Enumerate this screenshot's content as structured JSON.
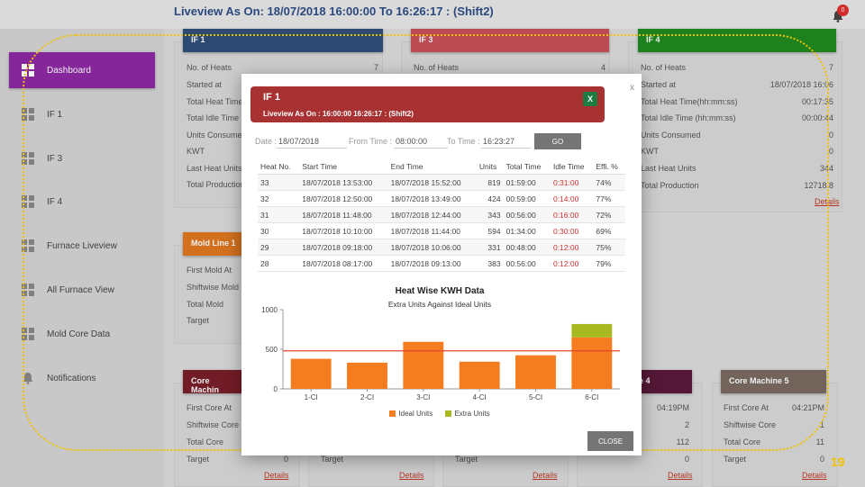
{
  "header": {
    "title": "Liveview As On: 18/07/2018 16:00:00 To 16:26:17   : (Shift2)",
    "notifications_count": "0"
  },
  "sidebar": {
    "items": [
      {
        "label": "Dashboard",
        "icon": "grid-icon",
        "active": true
      },
      {
        "label": "IF 1",
        "icon": "grid-icon"
      },
      {
        "label": "IF 3",
        "icon": "grid-icon"
      },
      {
        "label": "IF 4",
        "icon": "grid-icon"
      },
      {
        "label": "Furnace Liveview",
        "icon": "grid-icon"
      },
      {
        "label": "All Furnace View",
        "icon": "grid-icon"
      },
      {
        "label": "Mold Core Data",
        "icon": "grid-icon"
      },
      {
        "label": "Notifications",
        "icon": "bell-icon"
      }
    ]
  },
  "cards": {
    "if1": {
      "title": "IF 1",
      "color": "#2f4f7a",
      "rows": [
        "No. of Heats",
        "Started at",
        "Total Heat Time",
        "Total Idle Time",
        "Units Consume",
        "KWT",
        "Last Heat Units",
        "Total Production"
      ],
      "values": [
        "7"
      ]
    },
    "if3": {
      "title": "IF 3",
      "color": "#c8505a",
      "rows": [
        "No. of Heats"
      ],
      "values": [
        "4"
      ]
    },
    "if4": {
      "title": "IF 4",
      "color": "#1f8a1f",
      "rows": [
        "No. of Heats",
        "Started at",
        "Total Heat Time(hh:mm:ss)",
        "Total Idle Time (hh:mm:ss)",
        "Units Consumed",
        "KWT",
        "Last Heat Units",
        "Total Production"
      ],
      "values": [
        "7",
        "18/07/2018 16:06",
        "00:17:35",
        "00:00:44",
        "0",
        "0",
        "344",
        "12718.8"
      ],
      "details": "Details"
    },
    "mold1": {
      "title": "Mold Line 1",
      "color": "#e07820",
      "rows": [
        "First Mold At",
        "Shiftwise Mold",
        "Total Mold",
        "Target"
      ]
    },
    "core1": {
      "title": "Core Machin",
      "color": "#7a1e2a",
      "rows": [
        "First Core At",
        "Shiftwise Core",
        "Total Core",
        "Target"
      ],
      "values": [
        "0"
      ],
      "details": "Details"
    },
    "core2": {
      "rows": [
        "Target"
      ],
      "values": [
        "0"
      ],
      "details": "Details"
    },
    "core3": {
      "rows": [
        "Target"
      ],
      "values": [
        "0"
      ],
      "details": "Details"
    },
    "core4": {
      "title": "e 4",
      "color": "#5a1a3a",
      "values": [
        "04:19PM",
        "2",
        "112",
        "0"
      ],
      "details": "Details"
    },
    "core5": {
      "title": "Core Machine 5",
      "color": "#7a6b60",
      "rows": [
        "First Core At",
        "Shiftwise Core",
        "Total Core",
        "Target"
      ],
      "values": [
        "04:21PM",
        "1",
        "11",
        "0"
      ],
      "details": "Details"
    }
  },
  "slide_number": "19",
  "modal": {
    "close_x": "x",
    "title": "IF 1",
    "subtitle": "Liveview As On : 16:00:00  16:26:17 : (Shift2)",
    "excel_label": "X",
    "filters": {
      "date_label": "Date :",
      "date_value": "18/07/2018",
      "from_label": "From Time :",
      "from_value": "08:00:00",
      "to_label": "To Time :",
      "to_value": "16:23:27",
      "go_label": "GO"
    },
    "table": {
      "headers": [
        "Heat No.",
        "Start Time",
        "End Time",
        "Units",
        "Total Time",
        "Idle Time",
        "Effi. %"
      ],
      "rows": [
        [
          "33",
          "18/07/2018 13:53:00",
          "18/07/2018 15:52:00",
          "819",
          "01:59:00",
          "0:31:00",
          "74%"
        ],
        [
          "32",
          "18/07/2018 12:50:00",
          "18/07/2018 13:49:00",
          "424",
          "00:59:00",
          "0:14:00",
          "77%"
        ],
        [
          "31",
          "18/07/2018 11:48:00",
          "18/07/2018 12:44:00",
          "343",
          "00:56:00",
          "0:16:00",
          "72%"
        ],
        [
          "30",
          "18/07/2018 10:10:00",
          "18/07/2018 11:44:00",
          "594",
          "01:34:00",
          "0:30:00",
          "69%"
        ],
        [
          "29",
          "18/07/2018 09:18:00",
          "18/07/2018 10:06:00",
          "331",
          "00:48:00",
          "0:12:00",
          "75%"
        ],
        [
          "28",
          "18/07/2018 08:17:00",
          "18/07/2018 09:13:00",
          "383",
          "00:56:00",
          "0:12:00",
          "79%"
        ]
      ]
    },
    "close_label": "CLOSE"
  },
  "chart_data": {
    "type": "bar",
    "title": "Heat Wise KWH Data",
    "subtitle": "Extra Units Against Ideal Units",
    "categories": [
      "1-CI",
      "2-CI",
      "3-CI",
      "4-CI",
      "5-CI",
      "6-CI"
    ],
    "series": [
      {
        "name": "Ideal Units",
        "values": [
          380,
          331,
          594,
          343,
          424,
          650
        ],
        "color": "#f57c1f"
      },
      {
        "name": "Extra Units",
        "values": [
          0,
          0,
          0,
          0,
          0,
          169
        ],
        "color": "#a8b820"
      }
    ],
    "reference_line": 480,
    "ylim": [
      0,
      1000
    ],
    "yticks": [
      "0",
      "500",
      "1000"
    ],
    "stacked": true
  }
}
